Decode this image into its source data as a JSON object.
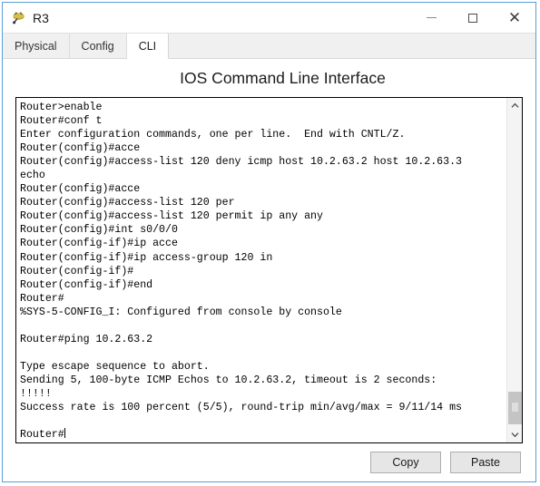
{
  "window": {
    "title": "R3",
    "icon": "router-icon",
    "controls": {
      "minimize": "minimize-icon",
      "maximize": "maximize-icon",
      "close": "close-icon"
    }
  },
  "tabs": [
    {
      "label": "Physical",
      "active": false
    },
    {
      "label": "Config",
      "active": false
    },
    {
      "label": "CLI",
      "active": true
    }
  ],
  "panel": {
    "title": "IOS Command Line Interface"
  },
  "terminal": {
    "lines": [
      "Router>enable",
      "Router#conf t",
      "Enter configuration commands, one per line.  End with CNTL/Z.",
      "Router(config)#acce",
      "Router(config)#access-list 120 deny icmp host 10.2.63.2 host 10.2.63.3",
      "echo",
      "Router(config)#acce",
      "Router(config)#access-list 120 per",
      "Router(config)#access-list 120 permit ip any any",
      "Router(config)#int s0/0/0",
      "Router(config-if)#ip acce",
      "Router(config-if)#ip access-group 120 in",
      "Router(config-if)#",
      "Router(config-if)#end",
      "Router#",
      "%SYS-5-CONFIG_I: Configured from console by console",
      "",
      "Router#ping 10.2.63.2",
      "",
      "Type escape sequence to abort.",
      "Sending 5, 100-byte ICMP Echos to 10.2.63.2, timeout is 2 seconds:",
      "!!!!!",
      "Success rate is 100 percent (5/5), round-trip min/avg/max = 9/11/14 ms",
      "",
      "Router#"
    ],
    "prompt_last": "Router#",
    "scrollbar": {
      "up_arrow": "chevron-up-icon",
      "down_arrow": "chevron-down-icon"
    }
  },
  "buttons": {
    "copy": "Copy",
    "paste": "Paste"
  },
  "colors": {
    "window_border": "#5aa0d8",
    "tab_active_bg": "#ffffff",
    "tab_bg": "#f0f0f0",
    "terminal_fg": "#000000",
    "terminal_bg": "#ffffff",
    "button_bg": "#e6e6e6"
  }
}
